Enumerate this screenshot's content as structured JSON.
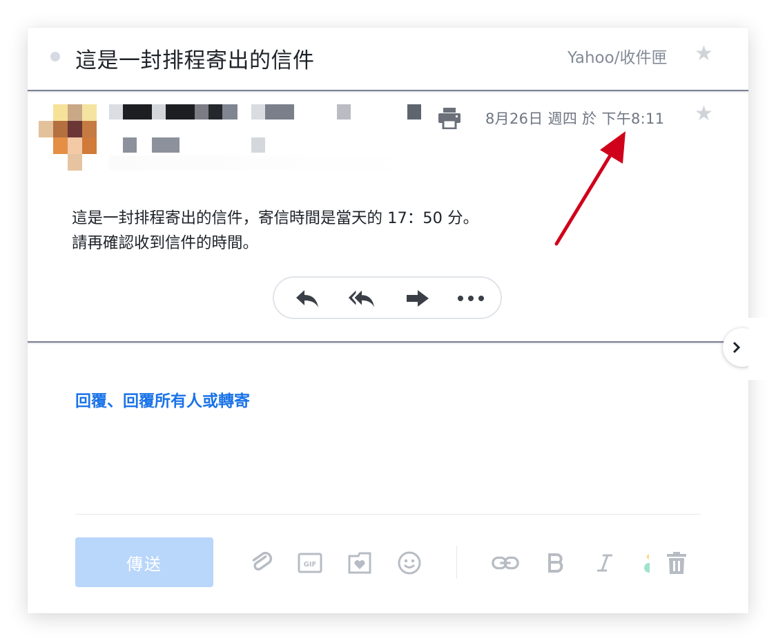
{
  "header": {
    "subject": "這是一封排程寄出的信件",
    "folder": "Yahoo/收件匣",
    "star_icon": "star-icon"
  },
  "message": {
    "date": "8月26日 週四 於 下午8:11",
    "body_lines": [
      "這是一封排程寄出的信件，寄信時間是當天的 17：50 分。",
      "請再確認收到信件的時間。"
    ],
    "actions": [
      "reply-icon",
      "reply-all-icon",
      "forward-icon",
      "more-icon"
    ]
  },
  "reply": {
    "link_reply": "回覆",
    "sep": "、",
    "link_reply_all": "回覆所有人",
    "or": "或",
    "link_forward": "轉寄"
  },
  "composer": {
    "send_label": "傳送",
    "toolbar": [
      "attach-icon",
      "gif-icon",
      "sticker-icon",
      "emoji-icon",
      "link-icon",
      "bold-icon",
      "italic-icon",
      "color-icon",
      "trash-icon"
    ]
  },
  "colors": {
    "link": "#1a73e8",
    "send_disabled": "#b9d6fb",
    "annotation_arrow": "#d0021b",
    "separator": "#7a7f92"
  }
}
